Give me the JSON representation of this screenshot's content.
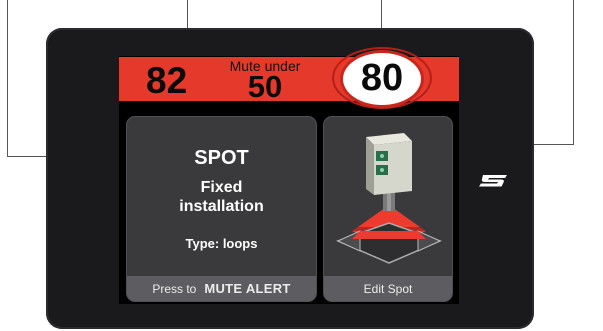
{
  "speed_bar": {
    "current_speed": "82",
    "mute_label": "Mute under",
    "mute_value": "50",
    "speed_limit": "80"
  },
  "alert_panel": {
    "type": "SPOT",
    "description_line1": "Fixed",
    "description_line2": "installation",
    "subtype": "Type: loops",
    "footer_prefix": "Press to",
    "footer_action": "MUTE ALERT"
  },
  "edit_panel": {
    "footer_label": "Edit Spot",
    "illustration": "speed-camera-icon"
  },
  "brand": {
    "logo": "s-brand-logo-icon"
  },
  "colors": {
    "speed_bar": "#e53a2b",
    "panel": "#3a3a3d",
    "panel_footer": "#5d5d61",
    "device_bezel": "#1a1a1c"
  }
}
